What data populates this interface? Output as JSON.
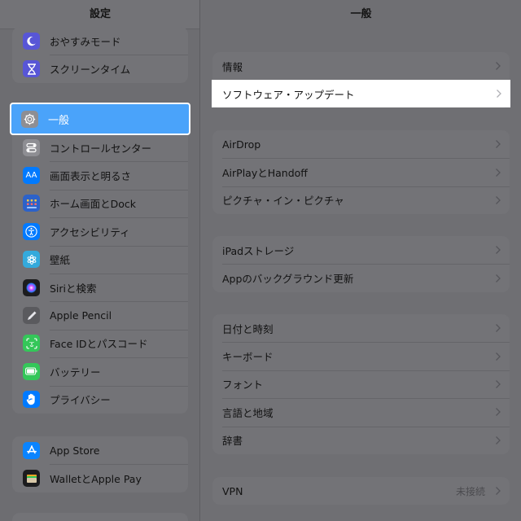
{
  "sidebar": {
    "title": "設定",
    "group1": [
      {
        "label": "おやすみモード",
        "icon": "moon-icon",
        "color": "#5856d6"
      },
      {
        "label": "スクリーンタイム",
        "icon": "hourglass-icon",
        "color": "#5856d6"
      }
    ],
    "selected": {
      "label": "一般",
      "icon": "gear-icon",
      "color": "#8e8e93"
    },
    "group2": [
      {
        "label": "コントロールセンター",
        "icon": "toggles-icon",
        "color": "#8e8e93"
      },
      {
        "label": "画面表示と明るさ",
        "icon": "text-size-icon",
        "color": "#007aff"
      },
      {
        "label": "ホーム画面とDock",
        "icon": "home-grid-icon",
        "color": "#2c62c9"
      },
      {
        "label": "アクセシビリティ",
        "icon": "accessibility-icon",
        "color": "#007aff"
      },
      {
        "label": "壁紙",
        "icon": "flower-icon",
        "color": "#34aadc"
      },
      {
        "label": "Siriと検索",
        "icon": "siri-icon",
        "color": "#1c1c1e"
      },
      {
        "label": "Apple Pencil",
        "icon": "pencil-icon",
        "color": "#5a5a5e"
      },
      {
        "label": "Face IDとパスコード",
        "icon": "face-id-icon",
        "color": "#34c759"
      },
      {
        "label": "バッテリー",
        "icon": "battery-icon",
        "color": "#34c759"
      },
      {
        "label": "プライバシー",
        "icon": "hand-icon",
        "color": "#007aff"
      }
    ],
    "group3": [
      {
        "label": "App Store",
        "icon": "app-store-icon",
        "color": "#0a84ff"
      },
      {
        "label": "WalletとApple Pay",
        "icon": "wallet-icon",
        "color": "#1c1c1e"
      }
    ]
  },
  "main": {
    "title": "一般",
    "highlighted": "ソフトウェア・アップデート",
    "group1": [
      {
        "label": "情報"
      }
    ],
    "group2": [
      {
        "label": "AirDrop"
      },
      {
        "label": "AirPlayとHandoff"
      },
      {
        "label": "ピクチャ・イン・ピクチャ"
      }
    ],
    "group3": [
      {
        "label": "iPadストレージ"
      },
      {
        "label": "Appのバックグラウンド更新"
      }
    ],
    "group4": [
      {
        "label": "日付と時刻"
      },
      {
        "label": "キーボード"
      },
      {
        "label": "フォント"
      },
      {
        "label": "言語と地域"
      },
      {
        "label": "辞書"
      }
    ],
    "group5": [
      {
        "label": "VPN",
        "value": "未接続"
      }
    ]
  }
}
